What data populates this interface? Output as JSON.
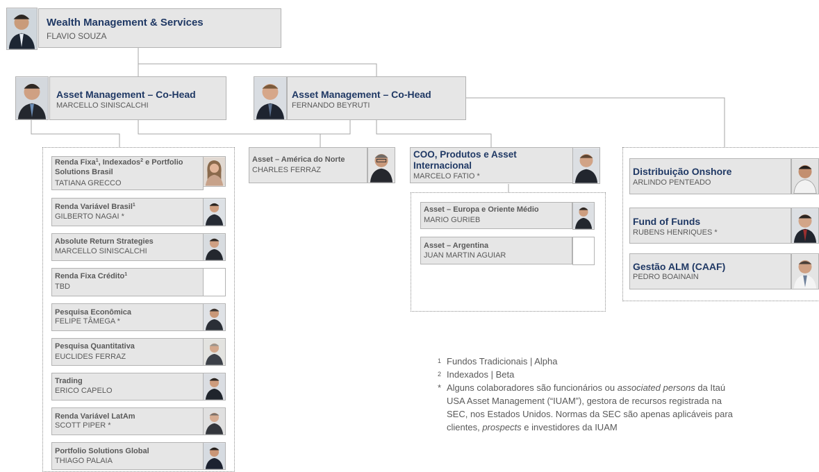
{
  "top": {
    "title": "Wealth Management & Services",
    "name": "FLAVIO SOUZA"
  },
  "co_head_1": {
    "title": "Asset Management – Co-Head",
    "name": "MARCELLO SINISCALCHI"
  },
  "co_head_2": {
    "title": "Asset Management – Co-Head",
    "name": "FERNANDO BEYRUTI"
  },
  "left_units": [
    {
      "title": "Renda Fixa",
      "sup1": "1",
      "mid": ", Indexados",
      "sup2": "2",
      "tail": " e Portfolio Solutions Brasil",
      "name": "TATIANA GRECCO"
    },
    {
      "title": "Renda Variável Brasil",
      "sup1": "1",
      "name": "GILBERTO NAGAI  *"
    },
    {
      "title": "Absolute Return Strategies",
      "name": "MARCELLO SINISCALCHI"
    },
    {
      "title": "Renda Fixa Crédito",
      "sup1": "1",
      "name": "TBD"
    },
    {
      "title": "Pesquisa Econômica",
      "name": "FELIPE TÂMEGA  *"
    },
    {
      "title": "Pesquisa Quantitativa",
      "name": "EUCLIDES FERRAZ"
    },
    {
      "title": "Trading",
      "name": "ERICO CAPELO"
    },
    {
      "title": "Renda Variável LatAm",
      "name": "SCOTT PIPER *"
    },
    {
      "title": "Portfolio Solutions Global",
      "name": "THIAGO  PALAIA"
    }
  ],
  "north_america": {
    "title": "Asset – América do Norte",
    "name": "CHARLES FERRAZ"
  },
  "coo": {
    "title": "COO, Produtos e Asset Internacional",
    "name": "MARCELO FATIO *"
  },
  "intl_units": [
    {
      "title": "Asset – Europa e Oriente Médio",
      "name": "MARIO  GURIEB"
    },
    {
      "title": "Asset – Argentina",
      "name": "JUAN  MARTIN  AGUIAR"
    }
  ],
  "right_units": [
    {
      "title": "Distribuição Onshore",
      "name": "ARLINDO PENTEADO"
    },
    {
      "title": "Fund of Funds",
      "name": "RUBENS HENRIQUES *"
    },
    {
      "title": "Gestão ALM (CAAF)",
      "name": "PEDRO BOAINAIN"
    }
  ],
  "footnotes": [
    {
      "mark": "1",
      "text": "Fundos Tradicionais  |  Alpha"
    },
    {
      "mark": "2",
      "text": "Indexados  |  Beta"
    },
    {
      "mark": "*",
      "pre": "Alguns colaboradores são funcionários ou ",
      "em1": "associated persons",
      "mid": " da Itaú USA Asset Management (“IUAM”), gestora de recursos registrada na SEC, nos Estados Unidos. Normas da SEC são apenas aplicáveis para clientes, ",
      "em2": "prospects",
      "post": " e investidores da IUAM"
    }
  ],
  "colors": {
    "box_fill": "#e6e6e6",
    "title": "#1f3864",
    "text": "#595959",
    "line": "#a6a6a6"
  }
}
